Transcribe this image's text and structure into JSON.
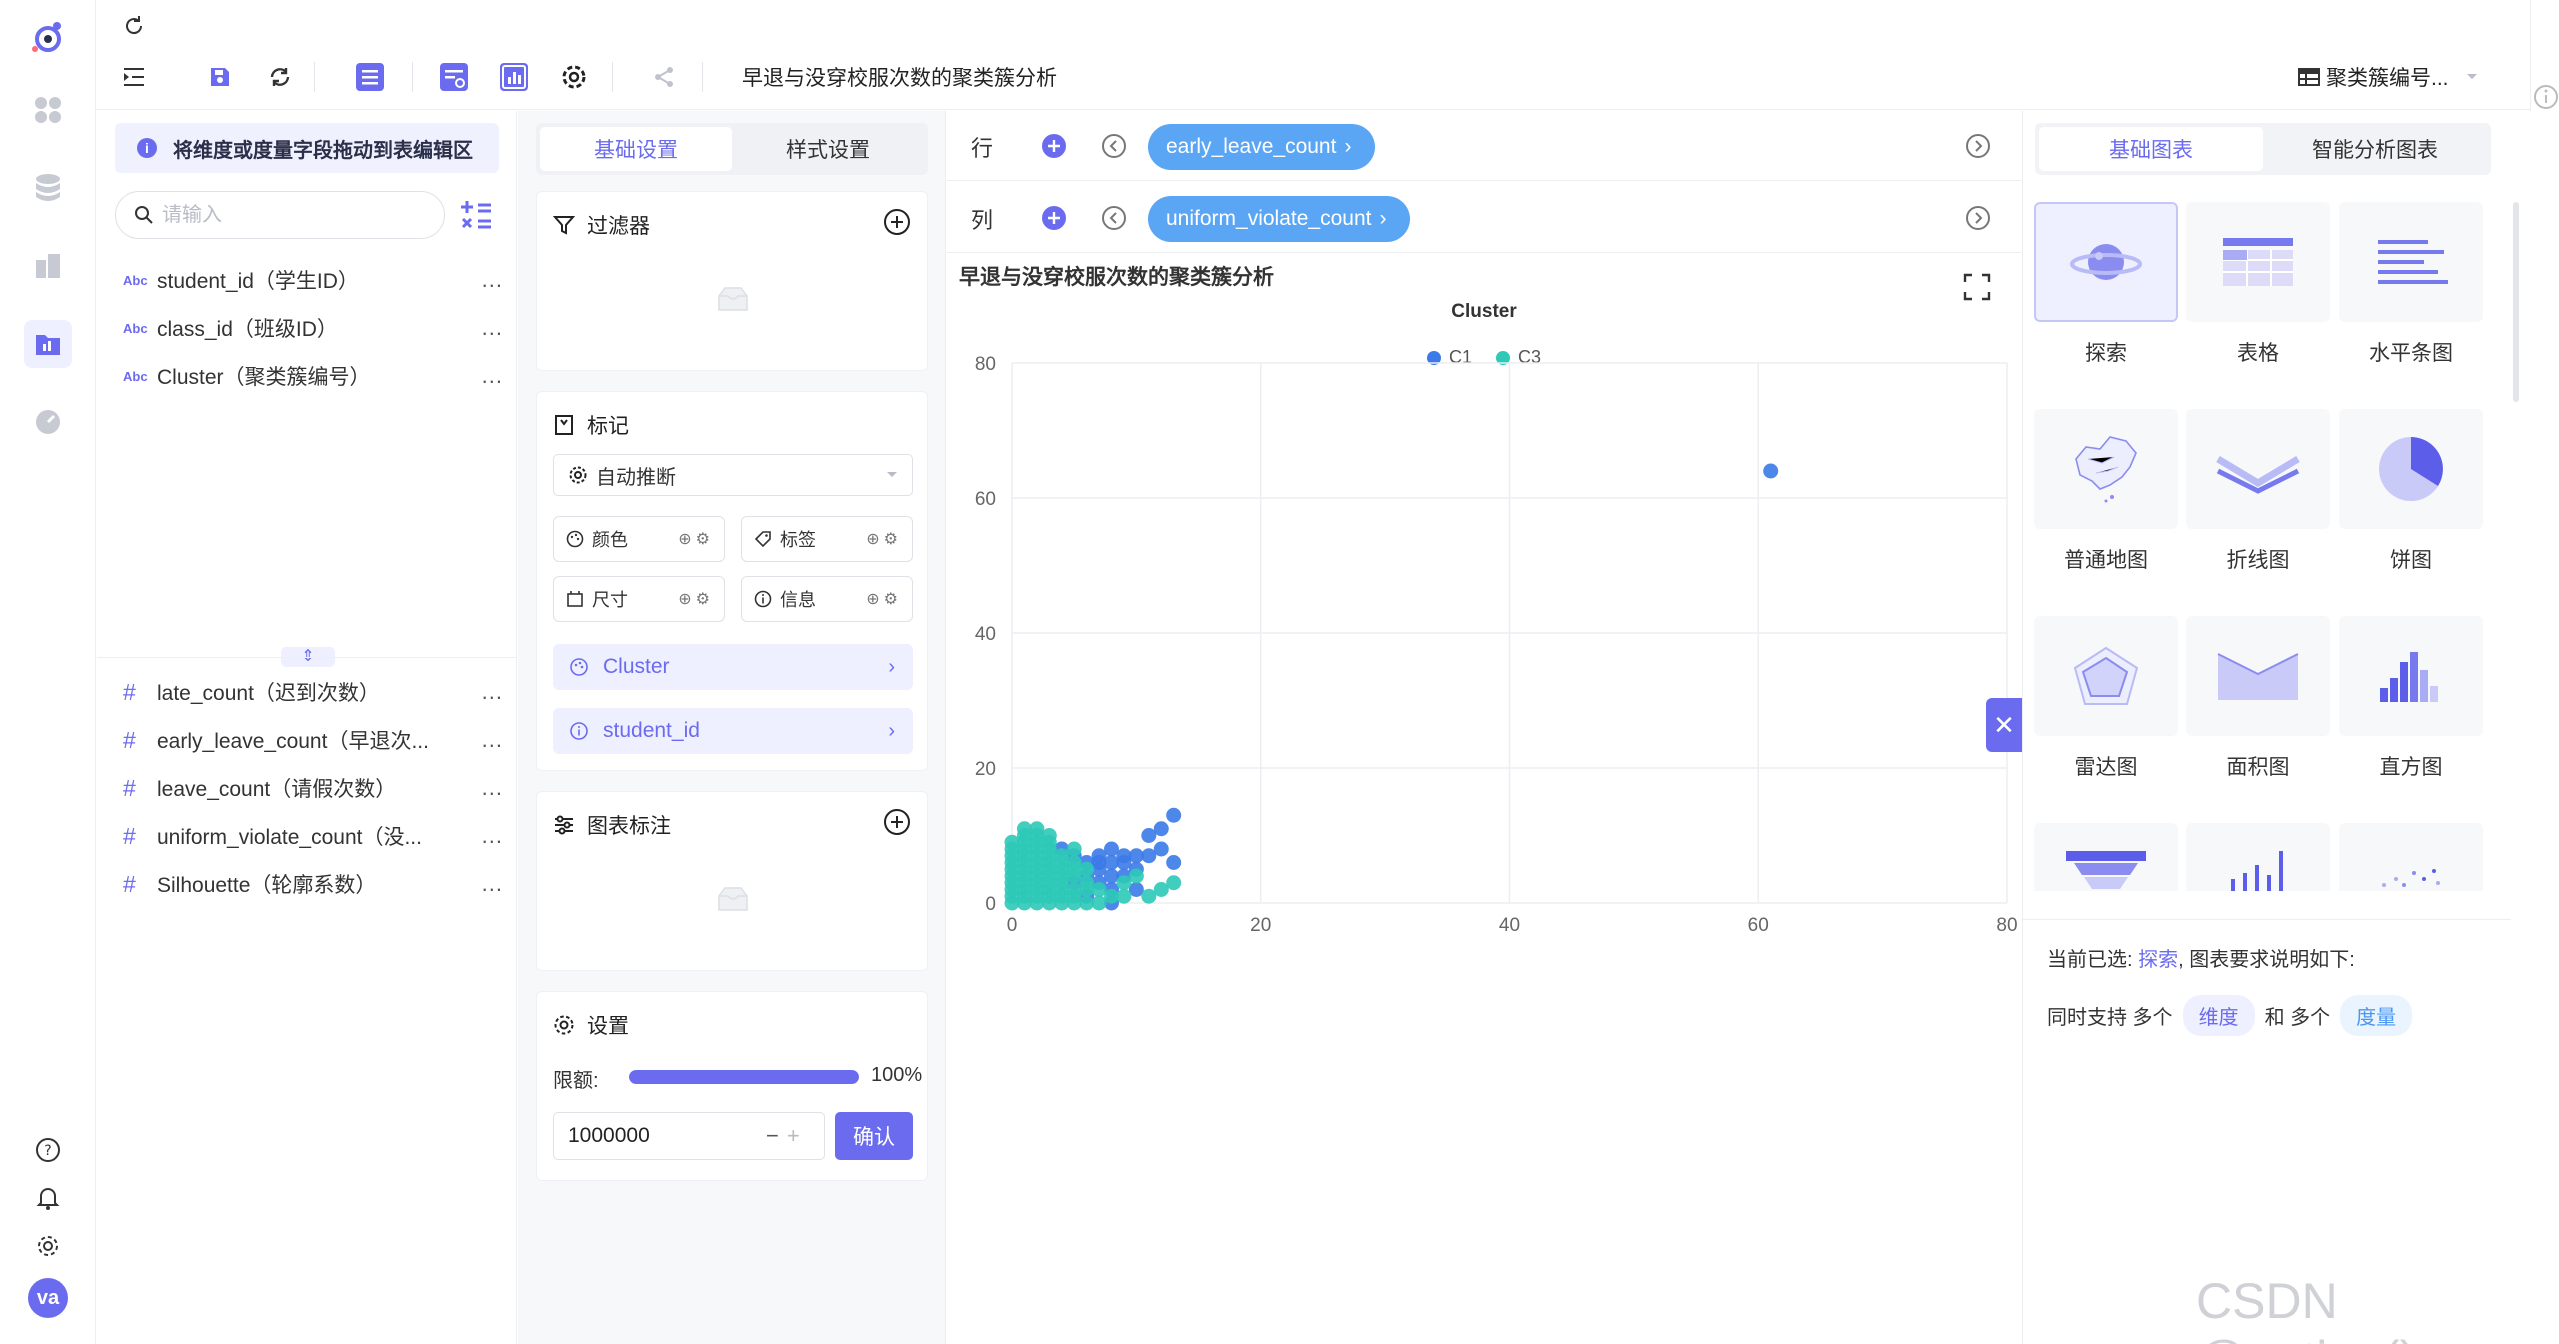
{
  "toolbar": {
    "title": "早退与没穿校服次数的聚类簇分析",
    "right_select": "聚类簇编号..."
  },
  "fields": {
    "hint": "将维度或度量字段拖动到表编辑区",
    "search_placeholder": "请输入",
    "dimensions": [
      {
        "type": "Abc",
        "name": "student_id（学生ID）"
      },
      {
        "type": "Abc",
        "name": "class_id（班级ID）"
      },
      {
        "type": "Abc",
        "name": "Cluster（聚类簇编号）"
      }
    ],
    "measures": [
      {
        "type": "#",
        "name": "late_count（迟到次数）"
      },
      {
        "type": "#",
        "name": "early_leave_count（早退次..."
      },
      {
        "type": "#",
        "name": "leave_count（请假次数）"
      },
      {
        "type": "#",
        "name": "uniform_violate_count（没..."
      },
      {
        "type": "#",
        "name": "Silhouette（轮廓系数）"
      }
    ],
    "more": "..."
  },
  "settings": {
    "tab_basic": "基础设置",
    "tab_style": "样式设置",
    "filter_title": "过滤器",
    "mark_title": "标记",
    "mark_select": "自动推断",
    "chips": [
      "颜色",
      "标签",
      "尺寸",
      "信息"
    ],
    "encodings": [
      "Cluster",
      "student_id"
    ],
    "annotation_title": "图表标注",
    "config_title": "设置",
    "limit_label": "限额:",
    "limit_percent": "100%",
    "limit_fraction": 1.0,
    "limit_value": "1000000",
    "confirm_label": "确认"
  },
  "shelves": {
    "row_label": "行",
    "row_field": "early_leave_count",
    "col_label": "列",
    "col_field": "uniform_violate_count"
  },
  "chart_data": {
    "type": "scatter",
    "title": "早退与没穿校服次数的聚类簇分析",
    "legend_title": "Cluster",
    "legend_position": "top",
    "xlim": [
      0,
      80
    ],
    "ylim": [
      0,
      80
    ],
    "x_ticks": [
      "0",
      "20",
      "40",
      "60",
      "80"
    ],
    "y_ticks": [
      "0",
      "20",
      "40",
      "60",
      "80"
    ],
    "grid": true,
    "series": [
      {
        "name": "C1",
        "color": "#3b7ae8",
        "points": [
          [
            61,
            64
          ],
          [
            13,
            13
          ],
          [
            12,
            11
          ],
          [
            11,
            10
          ],
          [
            12,
            8
          ],
          [
            13,
            6
          ],
          [
            11,
            7
          ],
          [
            8,
            8
          ],
          [
            7,
            7
          ],
          [
            9,
            7
          ],
          [
            10,
            7
          ],
          [
            8,
            6
          ],
          [
            9,
            6
          ],
          [
            6,
            6
          ],
          [
            7,
            6
          ],
          [
            10,
            5
          ],
          [
            7,
            5
          ],
          [
            8,
            4
          ],
          [
            9,
            4
          ],
          [
            6,
            4
          ],
          [
            7,
            3
          ],
          [
            5,
            3
          ],
          [
            8,
            2
          ],
          [
            10,
            2
          ],
          [
            6,
            1
          ],
          [
            8,
            0
          ],
          [
            5,
            7
          ],
          [
            4,
            8
          ]
        ]
      },
      {
        "name": "C3",
        "color": "#2ec9b7",
        "points": [
          [
            13,
            3
          ],
          [
            12,
            2
          ],
          [
            11,
            1
          ],
          [
            10,
            4
          ],
          [
            9,
            3
          ],
          [
            9,
            1
          ],
          [
            8,
            1
          ],
          [
            7,
            2
          ],
          [
            7,
            0
          ],
          [
            6,
            2
          ],
          [
            6,
            0
          ],
          [
            5,
            1
          ],
          [
            5,
            0
          ],
          [
            4,
            0
          ],
          [
            4,
            1
          ],
          [
            4,
            2
          ],
          [
            4,
            3
          ],
          [
            4,
            4
          ],
          [
            4,
            5
          ],
          [
            4,
            6
          ],
          [
            3,
            0
          ],
          [
            3,
            1
          ],
          [
            3,
            2
          ],
          [
            3,
            3
          ],
          [
            3,
            4
          ],
          [
            3,
            5
          ],
          [
            3,
            6
          ],
          [
            3,
            7
          ],
          [
            3,
            8
          ],
          [
            3,
            9
          ],
          [
            3,
            10
          ],
          [
            2,
            0
          ],
          [
            2,
            1
          ],
          [
            2,
            2
          ],
          [
            2,
            3
          ],
          [
            2,
            4
          ],
          [
            2,
            5
          ],
          [
            2,
            6
          ],
          [
            2,
            7
          ],
          [
            2,
            8
          ],
          [
            2,
            9
          ],
          [
            2,
            10
          ],
          [
            2,
            11
          ],
          [
            1,
            0
          ],
          [
            1,
            1
          ],
          [
            1,
            2
          ],
          [
            1,
            3
          ],
          [
            1,
            4
          ],
          [
            1,
            5
          ],
          [
            1,
            6
          ],
          [
            1,
            7
          ],
          [
            1,
            8
          ],
          [
            1,
            9
          ],
          [
            1,
            10
          ],
          [
            1,
            11
          ],
          [
            0,
            0
          ],
          [
            0,
            1
          ],
          [
            0,
            2
          ],
          [
            0,
            3
          ],
          [
            0,
            4
          ],
          [
            0,
            5
          ],
          [
            0,
            6
          ],
          [
            0,
            7
          ],
          [
            0,
            8
          ],
          [
            0,
            9
          ],
          [
            5,
            4
          ],
          [
            6,
            5
          ],
          [
            5,
            5
          ],
          [
            5,
            2
          ],
          [
            6,
            3
          ],
          [
            4,
            7
          ],
          [
            5,
            6
          ],
          [
            5,
            8
          ]
        ]
      }
    ]
  },
  "gallery": {
    "tab_basic": "基础图表",
    "tab_smart": "智能分析图表",
    "charts": [
      "探索",
      "表格",
      "水平条图",
      "普通地图",
      "折线图",
      "饼图",
      "雷达图",
      "面积图",
      "直方图"
    ],
    "current_prefix": "当前已选:",
    "current_value": "探索",
    "current_suffix": ", 图表要求说明如下:",
    "req_prefix": "同时支持 多个",
    "req_dim": "维度",
    "req_mid": "和 多个",
    "req_measure": "度量"
  },
  "user": {
    "avatar": "va"
  },
  "watermark": "CSDN @potion()",
  "colors": {
    "accent": "#6b6bf0",
    "pill": "#5aa6f5"
  }
}
